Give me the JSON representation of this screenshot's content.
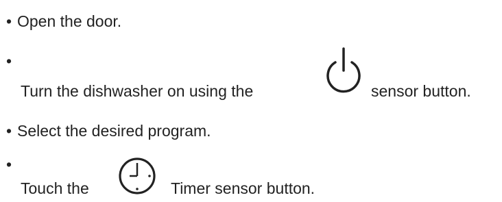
{
  "steps": [
    {
      "bullet": "•",
      "text": "Open the door."
    },
    {
      "bullet": "•",
      "text_before": "Turn the dishwasher on using the",
      "icon": "power-icon",
      "text_after": "sensor button."
    },
    {
      "bullet": "•",
      "text": "Select the desired program."
    },
    {
      "bullet": "•",
      "text_before": "Touch the",
      "icon": "clock-icon",
      "text_after": "Timer sensor button."
    }
  ]
}
